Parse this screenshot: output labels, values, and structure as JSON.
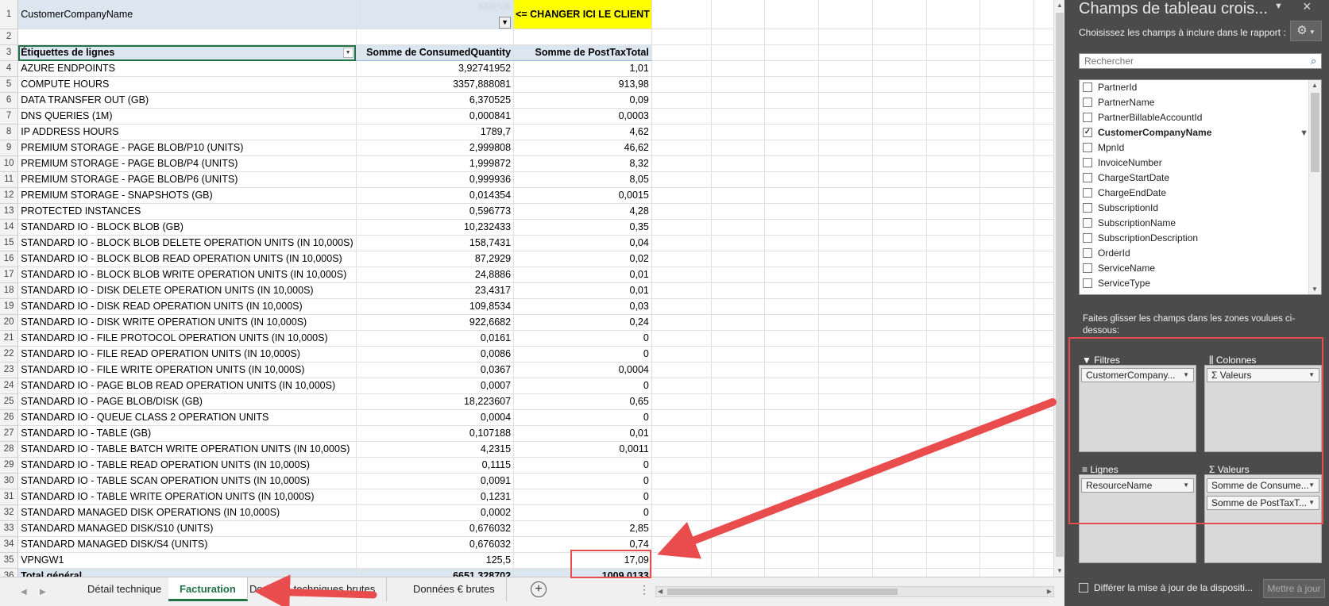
{
  "filter_row": {
    "label": "CustomerCompanyName",
    "value": "AREVA",
    "note": "<= CHANGER ICI LE CLIENT"
  },
  "pivot_table": {
    "headers": {
      "row_label": "Étiquettes de lignes",
      "qty": "Somme de ConsumedQuantity",
      "total": "Somme de PostTaxTotal"
    },
    "rows": [
      {
        "label": "AZURE ENDPOINTS",
        "qty": "3,92741952",
        "total": "1,01"
      },
      {
        "label": "COMPUTE HOURS",
        "qty": "3357,888081",
        "total": "913,98"
      },
      {
        "label": "DATA TRANSFER OUT (GB)",
        "qty": "6,370525",
        "total": "0,09"
      },
      {
        "label": "DNS QUERIES (1M)",
        "qty": "0,000841",
        "total": "0,0003"
      },
      {
        "label": "IP ADDRESS HOURS",
        "qty": "1789,7",
        "total": "4,62"
      },
      {
        "label": "PREMIUM STORAGE - PAGE BLOB/P10 (UNITS)",
        "qty": "2,999808",
        "total": "46,62"
      },
      {
        "label": "PREMIUM STORAGE - PAGE BLOB/P4 (UNITS)",
        "qty": "1,999872",
        "total": "8,32"
      },
      {
        "label": "PREMIUM STORAGE - PAGE BLOB/P6 (UNITS)",
        "qty": "0,999936",
        "total": "8,05"
      },
      {
        "label": "PREMIUM STORAGE - SNAPSHOTS (GB)",
        "qty": "0,014354",
        "total": "0,0015"
      },
      {
        "label": "PROTECTED INSTANCES",
        "qty": "0,596773",
        "total": "4,28"
      },
      {
        "label": "STANDARD IO - BLOCK BLOB (GB)",
        "qty": "10,232433",
        "total": "0,35"
      },
      {
        "label": "STANDARD IO - BLOCK BLOB DELETE OPERATION UNITS (IN 10,000S)",
        "qty": "158,7431",
        "total": "0,04"
      },
      {
        "label": "STANDARD IO - BLOCK BLOB READ OPERATION UNITS (IN 10,000S)",
        "qty": "87,2929",
        "total": "0,02"
      },
      {
        "label": "STANDARD IO - BLOCK BLOB WRITE OPERATION UNITS (IN 10,000S)",
        "qty": "24,8886",
        "total": "0,01"
      },
      {
        "label": "STANDARD IO - DISK DELETE OPERATION UNITS (IN 10,000S)",
        "qty": "23,4317",
        "total": "0,01"
      },
      {
        "label": "STANDARD IO - DISK READ OPERATION UNITS (IN 10,000S)",
        "qty": "109,8534",
        "total": "0,03"
      },
      {
        "label": "STANDARD IO - DISK WRITE OPERATION UNITS (IN 10,000S)",
        "qty": "922,6682",
        "total": "0,24"
      },
      {
        "label": "STANDARD IO - FILE PROTOCOL OPERATION UNITS (IN 10,000S)",
        "qty": "0,0161",
        "total": "0"
      },
      {
        "label": "STANDARD IO - FILE READ OPERATION UNITS (IN 10,000S)",
        "qty": "0,0086",
        "total": "0"
      },
      {
        "label": "STANDARD IO - FILE WRITE OPERATION UNITS (IN 10,000S)",
        "qty": "0,0367",
        "total": "0,0004"
      },
      {
        "label": "STANDARD IO - PAGE BLOB READ OPERATION UNITS (IN 10,000S)",
        "qty": "0,0007",
        "total": "0"
      },
      {
        "label": "STANDARD IO - PAGE BLOB/DISK (GB)",
        "qty": "18,223607",
        "total": "0,65"
      },
      {
        "label": "STANDARD IO - QUEUE CLASS 2 OPERATION UNITS",
        "qty": "0,0004",
        "total": "0"
      },
      {
        "label": "STANDARD IO - TABLE (GB)",
        "qty": "0,107188",
        "total": "0,01"
      },
      {
        "label": "STANDARD IO - TABLE BATCH WRITE OPERATION UNITS (IN 10,000S)",
        "qty": "4,2315",
        "total": "0,0011"
      },
      {
        "label": "STANDARD IO - TABLE READ OPERATION UNITS (IN 10,000S)",
        "qty": "0,1115",
        "total": "0"
      },
      {
        "label": "STANDARD IO - TABLE SCAN OPERATION UNITS (IN 10,000S)",
        "qty": "0,0091",
        "total": "0"
      },
      {
        "label": "STANDARD IO - TABLE WRITE OPERATION UNITS (IN 10,000S)",
        "qty": "0,1231",
        "total": "0"
      },
      {
        "label": "STANDARD MANAGED DISK OPERATIONS (IN 10,000S)",
        "qty": "0,0002",
        "total": "0"
      },
      {
        "label": "STANDARD MANAGED DISK/S10 (UNITS)",
        "qty": "0,676032",
        "total": "2,85"
      },
      {
        "label": "STANDARD MANAGED DISK/S4 (UNITS)",
        "qty": "0,676032",
        "total": "0,74"
      },
      {
        "label": "VPNGW1",
        "qty": "125,5",
        "total": "17,09"
      }
    ],
    "grand_total": {
      "label": "Total général",
      "qty": "6651,328702",
      "total": "1009,0133"
    }
  },
  "sheet_tabs": [
    {
      "label": "Détail technique",
      "active": false
    },
    {
      "label": "Facturation",
      "active": true
    },
    {
      "label": "Données techniques brutes",
      "active": false
    },
    {
      "label": "Données € brutes",
      "active": false
    }
  ],
  "pane": {
    "title": "Champs de tableau crois...",
    "subtitle": "Choisissez les champs à inclure dans le rapport :",
    "search_placeholder": "Rechercher",
    "fields": [
      {
        "label": "PartnerId",
        "checked": false
      },
      {
        "label": "PartnerName",
        "checked": false
      },
      {
        "label": "PartnerBillableAccountId",
        "checked": false
      },
      {
        "label": "CustomerCompanyName",
        "checked": true
      },
      {
        "label": "MpnId",
        "checked": false
      },
      {
        "label": "InvoiceNumber",
        "checked": false
      },
      {
        "label": "ChargeStartDate",
        "checked": false
      },
      {
        "label": "ChargeEndDate",
        "checked": false
      },
      {
        "label": "SubscriptionId",
        "checked": false
      },
      {
        "label": "SubscriptionName",
        "checked": false
      },
      {
        "label": "SubscriptionDescription",
        "checked": false
      },
      {
        "label": "OrderId",
        "checked": false
      },
      {
        "label": "ServiceName",
        "checked": false
      },
      {
        "label": "ServiceType",
        "checked": false
      }
    ],
    "drag_hint": "Faites glisser les champs dans les zones voulues ci-dessous:",
    "zones": {
      "filters": {
        "title": "Filtres",
        "items": [
          "CustomerCompany..."
        ]
      },
      "columns": {
        "title": "Colonnes",
        "items": [
          "Σ Valeurs"
        ]
      },
      "rows": {
        "title": "Lignes",
        "items": [
          "ResourceName"
        ]
      },
      "values": {
        "title": "Valeurs",
        "items": [
          "Somme de Consume...",
          "Somme de PostTaxT..."
        ]
      }
    },
    "defer_label": "Différer la mise à jour de la dispositi...",
    "update_label": "Mettre à jour"
  }
}
